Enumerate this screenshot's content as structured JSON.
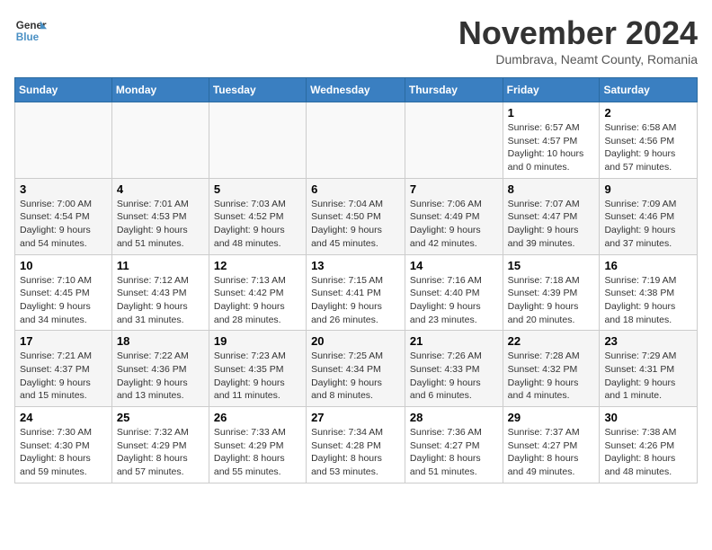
{
  "logo": {
    "line1": "General",
    "line2": "Blue"
  },
  "title": "November 2024",
  "location": "Dumbrava, Neamt County, Romania",
  "weekdays": [
    "Sunday",
    "Monday",
    "Tuesday",
    "Wednesday",
    "Thursday",
    "Friday",
    "Saturday"
  ],
  "weeks": [
    [
      {
        "day": "",
        "info": ""
      },
      {
        "day": "",
        "info": ""
      },
      {
        "day": "",
        "info": ""
      },
      {
        "day": "",
        "info": ""
      },
      {
        "day": "",
        "info": ""
      },
      {
        "day": "1",
        "info": "Sunrise: 6:57 AM\nSunset: 4:57 PM\nDaylight: 10 hours and 0 minutes."
      },
      {
        "day": "2",
        "info": "Sunrise: 6:58 AM\nSunset: 4:56 PM\nDaylight: 9 hours and 57 minutes."
      }
    ],
    [
      {
        "day": "3",
        "info": "Sunrise: 7:00 AM\nSunset: 4:54 PM\nDaylight: 9 hours and 54 minutes."
      },
      {
        "day": "4",
        "info": "Sunrise: 7:01 AM\nSunset: 4:53 PM\nDaylight: 9 hours and 51 minutes."
      },
      {
        "day": "5",
        "info": "Sunrise: 7:03 AM\nSunset: 4:52 PM\nDaylight: 9 hours and 48 minutes."
      },
      {
        "day": "6",
        "info": "Sunrise: 7:04 AM\nSunset: 4:50 PM\nDaylight: 9 hours and 45 minutes."
      },
      {
        "day": "7",
        "info": "Sunrise: 7:06 AM\nSunset: 4:49 PM\nDaylight: 9 hours and 42 minutes."
      },
      {
        "day": "8",
        "info": "Sunrise: 7:07 AM\nSunset: 4:47 PM\nDaylight: 9 hours and 39 minutes."
      },
      {
        "day": "9",
        "info": "Sunrise: 7:09 AM\nSunset: 4:46 PM\nDaylight: 9 hours and 37 minutes."
      }
    ],
    [
      {
        "day": "10",
        "info": "Sunrise: 7:10 AM\nSunset: 4:45 PM\nDaylight: 9 hours and 34 minutes."
      },
      {
        "day": "11",
        "info": "Sunrise: 7:12 AM\nSunset: 4:43 PM\nDaylight: 9 hours and 31 minutes."
      },
      {
        "day": "12",
        "info": "Sunrise: 7:13 AM\nSunset: 4:42 PM\nDaylight: 9 hours and 28 minutes."
      },
      {
        "day": "13",
        "info": "Sunrise: 7:15 AM\nSunset: 4:41 PM\nDaylight: 9 hours and 26 minutes."
      },
      {
        "day": "14",
        "info": "Sunrise: 7:16 AM\nSunset: 4:40 PM\nDaylight: 9 hours and 23 minutes."
      },
      {
        "day": "15",
        "info": "Sunrise: 7:18 AM\nSunset: 4:39 PM\nDaylight: 9 hours and 20 minutes."
      },
      {
        "day": "16",
        "info": "Sunrise: 7:19 AM\nSunset: 4:38 PM\nDaylight: 9 hours and 18 minutes."
      }
    ],
    [
      {
        "day": "17",
        "info": "Sunrise: 7:21 AM\nSunset: 4:37 PM\nDaylight: 9 hours and 15 minutes."
      },
      {
        "day": "18",
        "info": "Sunrise: 7:22 AM\nSunset: 4:36 PM\nDaylight: 9 hours and 13 minutes."
      },
      {
        "day": "19",
        "info": "Sunrise: 7:23 AM\nSunset: 4:35 PM\nDaylight: 9 hours and 11 minutes."
      },
      {
        "day": "20",
        "info": "Sunrise: 7:25 AM\nSunset: 4:34 PM\nDaylight: 9 hours and 8 minutes."
      },
      {
        "day": "21",
        "info": "Sunrise: 7:26 AM\nSunset: 4:33 PM\nDaylight: 9 hours and 6 minutes."
      },
      {
        "day": "22",
        "info": "Sunrise: 7:28 AM\nSunset: 4:32 PM\nDaylight: 9 hours and 4 minutes."
      },
      {
        "day": "23",
        "info": "Sunrise: 7:29 AM\nSunset: 4:31 PM\nDaylight: 9 hours and 1 minute."
      }
    ],
    [
      {
        "day": "24",
        "info": "Sunrise: 7:30 AM\nSunset: 4:30 PM\nDaylight: 8 hours and 59 minutes."
      },
      {
        "day": "25",
        "info": "Sunrise: 7:32 AM\nSunset: 4:29 PM\nDaylight: 8 hours and 57 minutes."
      },
      {
        "day": "26",
        "info": "Sunrise: 7:33 AM\nSunset: 4:29 PM\nDaylight: 8 hours and 55 minutes."
      },
      {
        "day": "27",
        "info": "Sunrise: 7:34 AM\nSunset: 4:28 PM\nDaylight: 8 hours and 53 minutes."
      },
      {
        "day": "28",
        "info": "Sunrise: 7:36 AM\nSunset: 4:27 PM\nDaylight: 8 hours and 51 minutes."
      },
      {
        "day": "29",
        "info": "Sunrise: 7:37 AM\nSunset: 4:27 PM\nDaylight: 8 hours and 49 minutes."
      },
      {
        "day": "30",
        "info": "Sunrise: 7:38 AM\nSunset: 4:26 PM\nDaylight: 8 hours and 48 minutes."
      }
    ]
  ]
}
